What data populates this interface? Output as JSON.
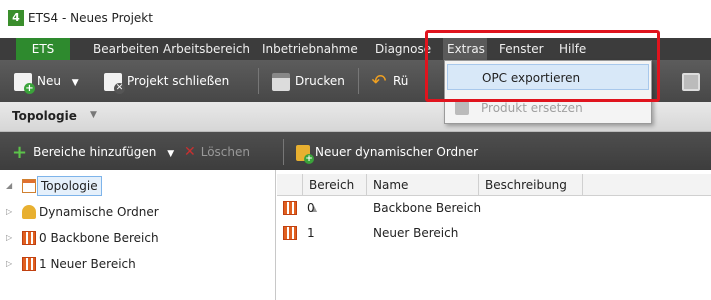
{
  "window": {
    "title": "ETS4 - Neues Projekt",
    "app_icon": "ets-app-icon"
  },
  "menubar": {
    "items": [
      "ETS",
      "Bearbeiten",
      "Arbeitsbereich",
      "Inbetriebnahme",
      "Diagnose",
      "Extras",
      "Fenster",
      "Hilfe"
    ],
    "active": "Extras"
  },
  "toolbar": {
    "new_label": "Neu",
    "close_project_label": "Projekt schließen",
    "print_label": "Drucken",
    "undo_label": "Rü"
  },
  "extras_menu": {
    "items": [
      {
        "label": "OPC exportieren",
        "state": "hover"
      },
      {
        "label": "Produkt ersetzen",
        "state": "disabled"
      }
    ]
  },
  "section": {
    "title": "Topologie"
  },
  "toolbar2": {
    "add_areas_label": "Bereiche hinzufügen",
    "delete_label": "Löschen",
    "new_dynamic_folder_label": "Neuer dynamischer Ordner"
  },
  "tree": {
    "items": [
      {
        "label": "Topologie",
        "icon": "topology-icon",
        "expanded": true,
        "selected": true
      },
      {
        "label": "Dynamische Ordner",
        "icon": "dynamic-folder-icon"
      },
      {
        "label": "0 Backbone Bereich",
        "icon": "area-icon"
      },
      {
        "label": "1 Neuer Bereich",
        "icon": "area-icon"
      }
    ]
  },
  "grid": {
    "columns": [
      "Bereich",
      "Name",
      "Beschreibung"
    ],
    "sort_indicator": "▲",
    "rows": [
      {
        "bereich": "0",
        "name": "Backbone Bereich",
        "beschreibung": ""
      },
      {
        "bereich": "1",
        "name": "Neuer Bereich",
        "beschreibung": ""
      }
    ]
  },
  "colors": {
    "menubar_bg": "#3c3c3c",
    "ets_menu_bg": "#2e8a2e",
    "highlight_border": "#e0141e",
    "hover_bg": "#d8e8f8"
  }
}
